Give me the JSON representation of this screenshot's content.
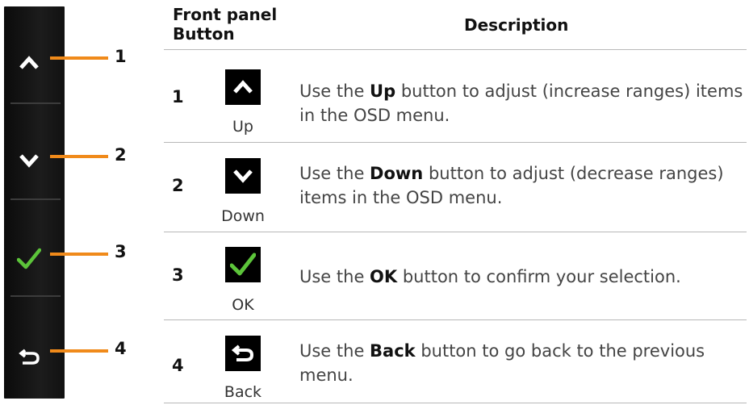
{
  "panel": {
    "callouts": [
      "1",
      "2",
      "3",
      "4"
    ],
    "icons": [
      "up-arrow-icon",
      "down-arrow-icon",
      "checkmark-icon",
      "back-arrow-icon"
    ],
    "accent_color": "#f08a1a",
    "check_color": "#5cc43a"
  },
  "table": {
    "header_col1": "Front panel Button",
    "header_col2": "Description",
    "rows": [
      {
        "number": "1",
        "icon": "up-arrow-icon",
        "label": "Up",
        "desc_prefix": "Use the ",
        "desc_bold": "Up",
        "desc_suffix": " button to adjust (increase ranges) items in the OSD menu."
      },
      {
        "number": "2",
        "icon": "down-arrow-icon",
        "label": "Down",
        "desc_prefix": "Use the ",
        "desc_bold": "Down",
        "desc_suffix": " button to adjust (decrease ranges) items in the OSD menu."
      },
      {
        "number": "3",
        "icon": "checkmark-icon",
        "label": "OK",
        "desc_prefix": "Use the ",
        "desc_bold": "OK",
        "desc_suffix": " button to confirm your selection."
      },
      {
        "number": "4",
        "icon": "back-arrow-icon",
        "label": "Back",
        "desc_prefix": "Use the ",
        "desc_bold": "Back",
        "desc_suffix": " button to go back to the previous menu."
      }
    ]
  }
}
